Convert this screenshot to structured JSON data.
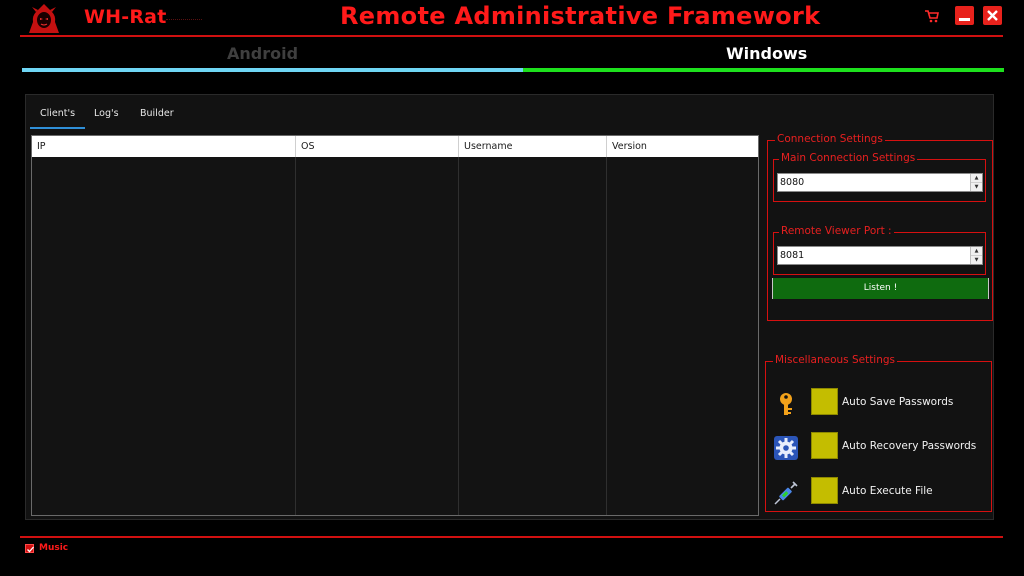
{
  "app": {
    "name": "WH-Rat",
    "title": "Remote Administrative Framework"
  },
  "platform_tabs": [
    {
      "label": "Android",
      "active": false
    },
    {
      "label": "Windows",
      "active": true
    }
  ],
  "sub_tabs": [
    {
      "label": "Client's",
      "active": true
    },
    {
      "label": "Log's",
      "active": false
    },
    {
      "label": "Builder",
      "active": false
    }
  ],
  "clients_table": {
    "columns": [
      "IP",
      "OS",
      "Username",
      "Version"
    ],
    "rows": []
  },
  "connection_settings": {
    "title": "Connection Settings",
    "main_group_title": "Main Connection Settings",
    "main_port": "8080",
    "viewer_group_title": "Remote Viewer Port :",
    "viewer_port": "8081",
    "listen_label": "Listen !"
  },
  "misc_settings": {
    "title": "Miscellaneous Settings",
    "options": [
      {
        "label": "Auto Save Passwords",
        "icon": "key-icon"
      },
      {
        "label": "Auto Recovery Passwords",
        "icon": "gear-icon"
      },
      {
        "label": "Auto Execute File",
        "icon": "syringe-icon"
      }
    ]
  },
  "footer": {
    "music_label": "Music",
    "music_checked": true
  },
  "colors": {
    "accent_red": "#ff1a1a",
    "android_bar": "#6fd6f5",
    "windows_bar": "#1de01d",
    "listen_green": "#0f6b0f",
    "checkbox_olive": "#c4bd00"
  }
}
